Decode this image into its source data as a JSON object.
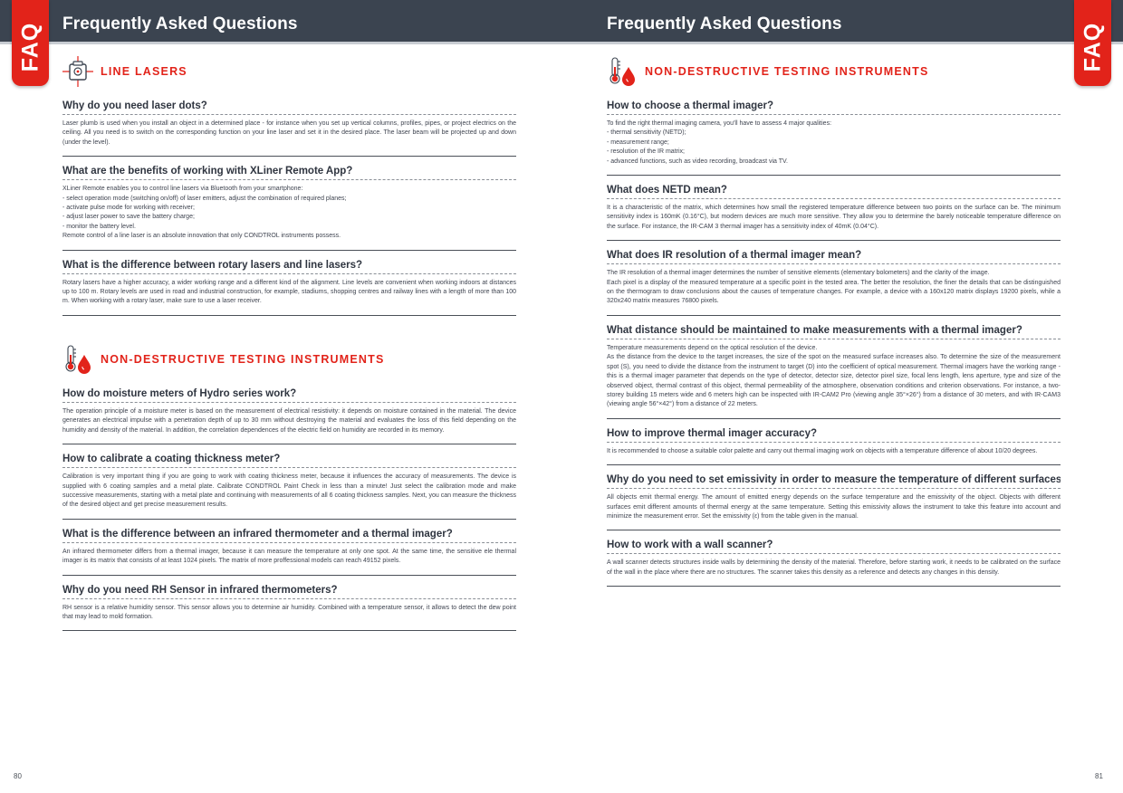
{
  "header": {
    "tab_label": "FAQ"
  },
  "colors": {
    "accent": "#e2231a",
    "header_bg": "#3b4450"
  },
  "left": {
    "title": "Frequently Asked Questions",
    "page_number": "80",
    "section1": {
      "icon": "laser-level-icon",
      "title": "LINE LASERS",
      "items": [
        {
          "q": "Why do you need laser dots?",
          "a": "Laser plumb is used when you install an object in a determined place -  for instance when you set up vertical columns, profiles, pipes, or project electrics on the ceiling.  All you need is to switch on the corresponding function on your line laser and set it in the desired place. The laser beam will be projected up and  down (under the level)."
        },
        {
          "q": "What are the benefits of working with XLiner Remote App?",
          "a": "XLiner Remote enables you to control line lasers via Bluetooth from your smartphone:\n- select operation mode (switching on/off) of laser emitters, adjust the combination of required planes;\n- activate pulse mode for working with receiver;\n- adjust laser power to save the battery charge;\n- monitor the battery level.\nRemote control of a line laser is an absolute innovation that only CONDTROL instruments possess."
        },
        {
          "q": "What is the difference between rotary lasers and line lasers?",
          "a": "Rotary lasers have a higher accuracy, a wider working range and a different kind of the alignment. Line levels are convenient when working indoors at distances up to 100 m. Rotary levels are used in road and industrial construction, for example, stadiums, shopping centres and railway lines with a length of more than 100 m. When working with a rotary laser, make sure to use a laser receiver."
        }
      ]
    },
    "section2": {
      "icon": "thermometer-drop-icon",
      "title": "NON-DESTRUCTIVE TESTING INSTRUMENTS",
      "items": [
        {
          "q": "How do moisture meters of Hydro series work?",
          "a": "The operation principle of a moisture meter is based on the measurement of electrical resistivity: it depends on moisture contained in the material. The device generates an electrical impulse with a penetration depth of up to 30 mm without destroying the material and evaluates the loss of this field depending on the humidity and density of the material. In addition, the correlation dependences of the electric field on humidity are recorded in its memory."
        },
        {
          "q": "How to calibrate a coating thickness meter?",
          "a": "Calibration is very important thing if you are going to work with coating thickness meter, because it influences the accuracy of measurements. The device is supplied with 6 coating samples and a metal plate. Calibrate CONDTROL Paint Check in less than a minute! Just select the calibration mode and make successive measurements, starting with a metal plate and continuing with measurements of all 6 coating thickness samples. Next, you can measure the thickness of the desired object and get precise measurement results."
        },
        {
          "q": "What is the difference between an infrared thermometer and a thermal imager?",
          "a": "An infrared thermometer differs from a thermal imager, because it can measure the temperature at only one spot. At the same time, the sensitive ele thermal imager is its matrix that consists of at least 1024 pixels. The matrix of more proffessional models can reach 49152 pixels."
        },
        {
          "q": "Why do you need RH Sensor in infrared thermometers?",
          "a": "RH sensor is a relative humidity sensor. This sensor allows you to determine air humidity. Combined with a temperature sensor, it allows to detect the dew point that may lead to mold formation."
        }
      ]
    }
  },
  "right": {
    "title": "Frequently Asked Questions",
    "page_number": "81",
    "section1": {
      "icon": "thermometer-drop-icon",
      "title": "NON-DESTRUCTIVE TESTING INSTRUMENTS",
      "items": [
        {
          "q": "How to choose a thermal imager?",
          "a": "To find the right thermal imaging camera, you'll have to assess 4 major qualities:\n- thermal sensitivity (NETD);\n- measurement range;\n- resolution of the IR matrix;\n- advanced functions, such as video recording, broadcast via TV."
        },
        {
          "q": "What does NETD mean?",
          "a": "It is a characteristic of the matrix, which determines how small the registered temperature difference between two points on the surface can be. The minimum sensitivity index is 160mK (0.16°C), but modern devices are much more sensitive. They allow you to determine the barely noticeable temperature difference on the surface. For instance, the IR-CAM 3 thermal imager has a sensitivity index of 40mK (0.04°C)."
        },
        {
          "q": "What does IR resolution of a thermal imager mean?",
          "a": "The IR resolution of a thermal imager determines the number of sensitive elements (elementary bolometers) and the clarity of the image.\nEach pixel is a display of the measured temperature at a specific point in the tested area. The better the resolution, the finer the details that can be distinguished on the thermogram to draw conclusions about the causes of temperature changes. For example, a device with a 160x120 matrix displays 19200 pixels, while a 320x240 matrix measures 76800 pixels."
        },
        {
          "q": "What distance should be maintained to make measurements with a thermal imager?",
          "a": "Temperature measurements depend on the optical resolution of the device.\nAs the distance from the device to the target increases, the size of the spot on the measured surface increases also. To determine the size of the measurement spot (S), you need to divide the distance from the instrument to target (D) into the coefficient of optical measurement. Thermal imagers have the working range - this is a thermal imager parameter that depends on the type of detector, detector size, detector pixel size, focal lens length, lens aperture, type and size of the observed object, thermal contrast of this object, thermal permeability of the atmosphere, observation conditions and criterion observations. For instance, a two-storey building 15 meters wide and 6 meters high can be inspected with IR-CAM2 Pro (viewing angle 35°×26°) from a distance of 30 meters, and with IR-CAM3 (viewing angle 56°×42°) from a distance of 22 meters."
        },
        {
          "q": "How to improve thermal imager accuracy?",
          "a": "It is recommended to choose a suitable color palette and carry out thermal imaging work on objects with a temperature difference of about 10/20 degrees."
        },
        {
          "q": "Why do you need to set emissivity in order to measure the temperature of different surfaces?",
          "a": "All objects emit thermal energy. The amount of emitted energy depends on the surface temperature and the emissivity of the object. Objects with different surfaces emit different amounts of thermal energy at the same temperature. Setting this emissivity allows the instrument to take this feature into account and minimize the measurement error. Set the emissivity (ε) from the table given in the manual."
        },
        {
          "q": "How to work with a wall scanner?",
          "a": "A wall scanner detects structures inside walls by determining the density of the material. Therefore, before starting work, it needs to be calibrated on the surface of the wall in the place where there are no structures. The scanner takes this density as a reference and detects any changes in this density."
        }
      ]
    }
  }
}
